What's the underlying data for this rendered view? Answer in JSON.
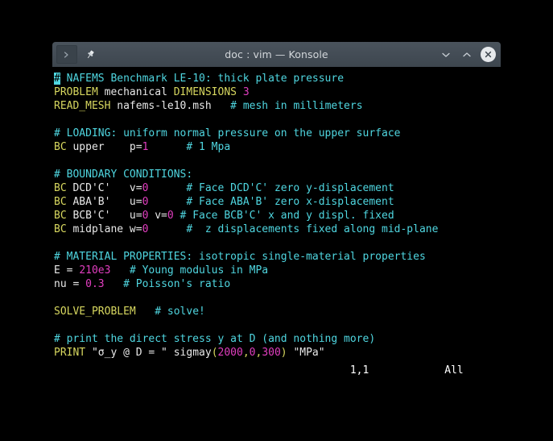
{
  "window": {
    "title": "doc : vim — Konsole",
    "tab_icon": "terminal-prompt-icon",
    "pin_icon": "pin-icon",
    "minimize_icon": "chevron-down-icon",
    "maximize_icon": "chevron-up-icon",
    "close_icon": "close-icon"
  },
  "colors": {
    "comment": "#4fd6e0",
    "keyword": "#d7d75f",
    "number": "#e23ec0",
    "text": "#e8e8e8",
    "background": "#000000",
    "titlebar": "#434c55",
    "cursor": "#4fd6e0"
  },
  "editor": {
    "lines": [
      [
        {
          "t": "#",
          "c": "cursor"
        },
        {
          "t": " NAFEMS Benchmark LE-10: thick plate pressure",
          "c": "c-comment"
        }
      ],
      [
        {
          "t": "PROBLEM",
          "c": "c-keyword"
        },
        {
          "t": " mechanical ",
          "c": "c-ident"
        },
        {
          "t": "DIMENSIONS",
          "c": "c-keyword"
        },
        {
          "t": " ",
          "c": "c-ident"
        },
        {
          "t": "3",
          "c": "c-number"
        }
      ],
      [
        {
          "t": "READ_MESH",
          "c": "c-keyword"
        },
        {
          "t": " nafems-le10.msh   ",
          "c": "c-ident"
        },
        {
          "t": "# mesh in millimeters",
          "c": "c-comment"
        }
      ],
      [],
      [
        {
          "t": "# LOADING: uniform normal pressure on the upper surface",
          "c": "c-comment"
        }
      ],
      [
        {
          "t": "BC",
          "c": "c-keyword"
        },
        {
          "t": " upper    p=",
          "c": "c-ident"
        },
        {
          "t": "1",
          "c": "c-number"
        },
        {
          "t": "      ",
          "c": "c-ident"
        },
        {
          "t": "# 1 Mpa",
          "c": "c-comment"
        }
      ],
      [],
      [
        {
          "t": "# BOUNDARY CONDITIONS:",
          "c": "c-comment"
        }
      ],
      [
        {
          "t": "BC",
          "c": "c-keyword"
        },
        {
          "t": " DCD'C'   v=",
          "c": "c-ident"
        },
        {
          "t": "0",
          "c": "c-number"
        },
        {
          "t": "      ",
          "c": "c-ident"
        },
        {
          "t": "# Face DCD'C' zero y-displacement",
          "c": "c-comment"
        }
      ],
      [
        {
          "t": "BC",
          "c": "c-keyword"
        },
        {
          "t": " ABA'B'   u=",
          "c": "c-ident"
        },
        {
          "t": "0",
          "c": "c-number"
        },
        {
          "t": "      ",
          "c": "c-ident"
        },
        {
          "t": "# Face ABA'B' zero x-displacement",
          "c": "c-comment"
        }
      ],
      [
        {
          "t": "BC",
          "c": "c-keyword"
        },
        {
          "t": " BCB'C'   u=",
          "c": "c-ident"
        },
        {
          "t": "0",
          "c": "c-number"
        },
        {
          "t": " v=",
          "c": "c-ident"
        },
        {
          "t": "0",
          "c": "c-number"
        },
        {
          "t": " ",
          "c": "c-ident"
        },
        {
          "t": "# Face BCB'C' x and y displ. fixed",
          "c": "c-comment"
        }
      ],
      [
        {
          "t": "BC",
          "c": "c-keyword"
        },
        {
          "t": " midplane w=",
          "c": "c-ident"
        },
        {
          "t": "0",
          "c": "c-number"
        },
        {
          "t": "      ",
          "c": "c-ident"
        },
        {
          "t": "#  z displacements fixed along mid-plane",
          "c": "c-comment"
        }
      ],
      [],
      [
        {
          "t": "# MATERIAL PROPERTIES: isotropic single-material properties",
          "c": "c-comment"
        }
      ],
      [
        {
          "t": "E = ",
          "c": "c-ident"
        },
        {
          "t": "210e3",
          "c": "c-number"
        },
        {
          "t": "   ",
          "c": "c-ident"
        },
        {
          "t": "# Young modulus in MPa",
          "c": "c-comment"
        }
      ],
      [
        {
          "t": "nu = ",
          "c": "c-ident"
        },
        {
          "t": "0.3",
          "c": "c-number"
        },
        {
          "t": "   ",
          "c": "c-ident"
        },
        {
          "t": "# Poisson's ratio",
          "c": "c-comment"
        }
      ],
      [],
      [
        {
          "t": "SOLVE_PROBLEM",
          "c": "c-keyword"
        },
        {
          "t": "   ",
          "c": "c-ident"
        },
        {
          "t": "# solve!",
          "c": "c-comment"
        }
      ],
      [],
      [
        {
          "t": "# print the direct stress y at D (and nothing more)",
          "c": "c-comment"
        }
      ],
      [
        {
          "t": "PRINT",
          "c": "c-keyword"
        },
        {
          "t": " \"σ_y @ D = \" sigmay",
          "c": "c-string"
        },
        {
          "t": "(",
          "c": "c-punct"
        },
        {
          "t": "2000",
          "c": "c-number"
        },
        {
          "t": ",",
          "c": "c-punct"
        },
        {
          "t": "0",
          "c": "c-number"
        },
        {
          "t": ",",
          "c": "c-punct"
        },
        {
          "t": "300",
          "c": "c-number"
        },
        {
          "t": ")",
          "c": "c-punct"
        },
        {
          "t": " \"MPa\"",
          "c": "c-string"
        }
      ]
    ]
  },
  "status": {
    "cursor_position": "1,1",
    "scroll_position": "All",
    "line": "                                               1,1            All"
  }
}
